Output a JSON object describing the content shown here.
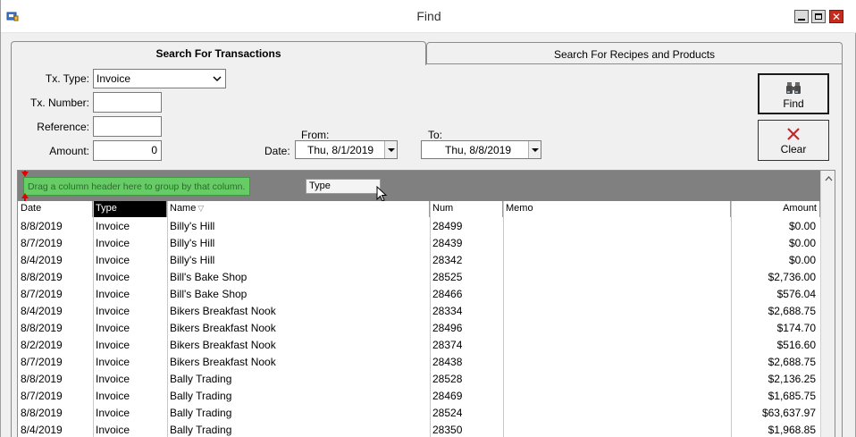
{
  "window": {
    "title": "Find"
  },
  "tabs": [
    {
      "label": "Search For Transactions",
      "active": true
    },
    {
      "label": "Search For Recipes and Products",
      "active": false
    }
  ],
  "form": {
    "tx_type_label": "Tx. Type:",
    "tx_type_value": "Invoice",
    "tx_number_label": "Tx. Number:",
    "tx_number_value": "",
    "reference_label": "Reference:",
    "reference_value": "",
    "amount_label": "Amount:",
    "amount_value": "0",
    "date_label": "Date:",
    "from_label": "From:",
    "from_value": "Thu, 8/1/2019",
    "to_label": "To:",
    "to_value": "Thu, 8/8/2019"
  },
  "buttons": {
    "find": "Find",
    "clear": "Clear"
  },
  "grid": {
    "group_hint": "Drag a column header here to group by that column.",
    "drag_ghost": "Type",
    "columns": [
      "Date",
      "Type",
      "Name",
      "Num",
      "Memo",
      "Amount"
    ],
    "rows": [
      [
        "8/8/2019",
        "Invoice",
        "Billy's Hill",
        "28499",
        "",
        "$0.00"
      ],
      [
        "8/7/2019",
        "Invoice",
        "Billy's Hill",
        "28439",
        "",
        "$0.00"
      ],
      [
        "8/4/2019",
        "Invoice",
        "Billy's Hill",
        "28342",
        "",
        "$0.00"
      ],
      [
        "8/8/2019",
        "Invoice",
        "Bill's Bake Shop",
        "28525",
        "",
        "$2,736.00"
      ],
      [
        "8/7/2019",
        "Invoice",
        "Bill's Bake Shop",
        "28466",
        "",
        "$576.04"
      ],
      [
        "8/4/2019",
        "Invoice",
        "Bikers Breakfast Nook",
        "28334",
        "",
        "$2,688.75"
      ],
      [
        "8/8/2019",
        "Invoice",
        "Bikers Breakfast Nook",
        "28496",
        "",
        "$174.70"
      ],
      [
        "8/2/2019",
        "Invoice",
        "Bikers Breakfast Nook",
        "28374",
        "",
        "$516.60"
      ],
      [
        "8/7/2019",
        "Invoice",
        "Bikers Breakfast Nook",
        "28438",
        "",
        "$2,688.75"
      ],
      [
        "8/8/2019",
        "Invoice",
        "Bally Trading",
        "28528",
        "",
        "$2,136.25"
      ],
      [
        "8/7/2019",
        "Invoice",
        "Bally Trading",
        "28469",
        "",
        "$1,685.75"
      ],
      [
        "8/8/2019",
        "Invoice",
        "Bally Trading",
        "28524",
        "",
        "$63,637.97"
      ],
      [
        "8/4/2019",
        "Invoice",
        "Bally Trading",
        "28350",
        "",
        "$1,968.85"
      ]
    ]
  },
  "icons": {
    "app": "app-icon",
    "find": "binoculars-icon",
    "clear": "red-x-icon",
    "sort": "sort-filter-icon"
  },
  "colors": {
    "group_hint_bg": "#66cc66",
    "group_bar_bg": "#808080",
    "selected_header_bg": "#000000",
    "clear_icon": "#c0282d",
    "close_button": "#c42b1c",
    "drag_marker": "#e00000"
  }
}
